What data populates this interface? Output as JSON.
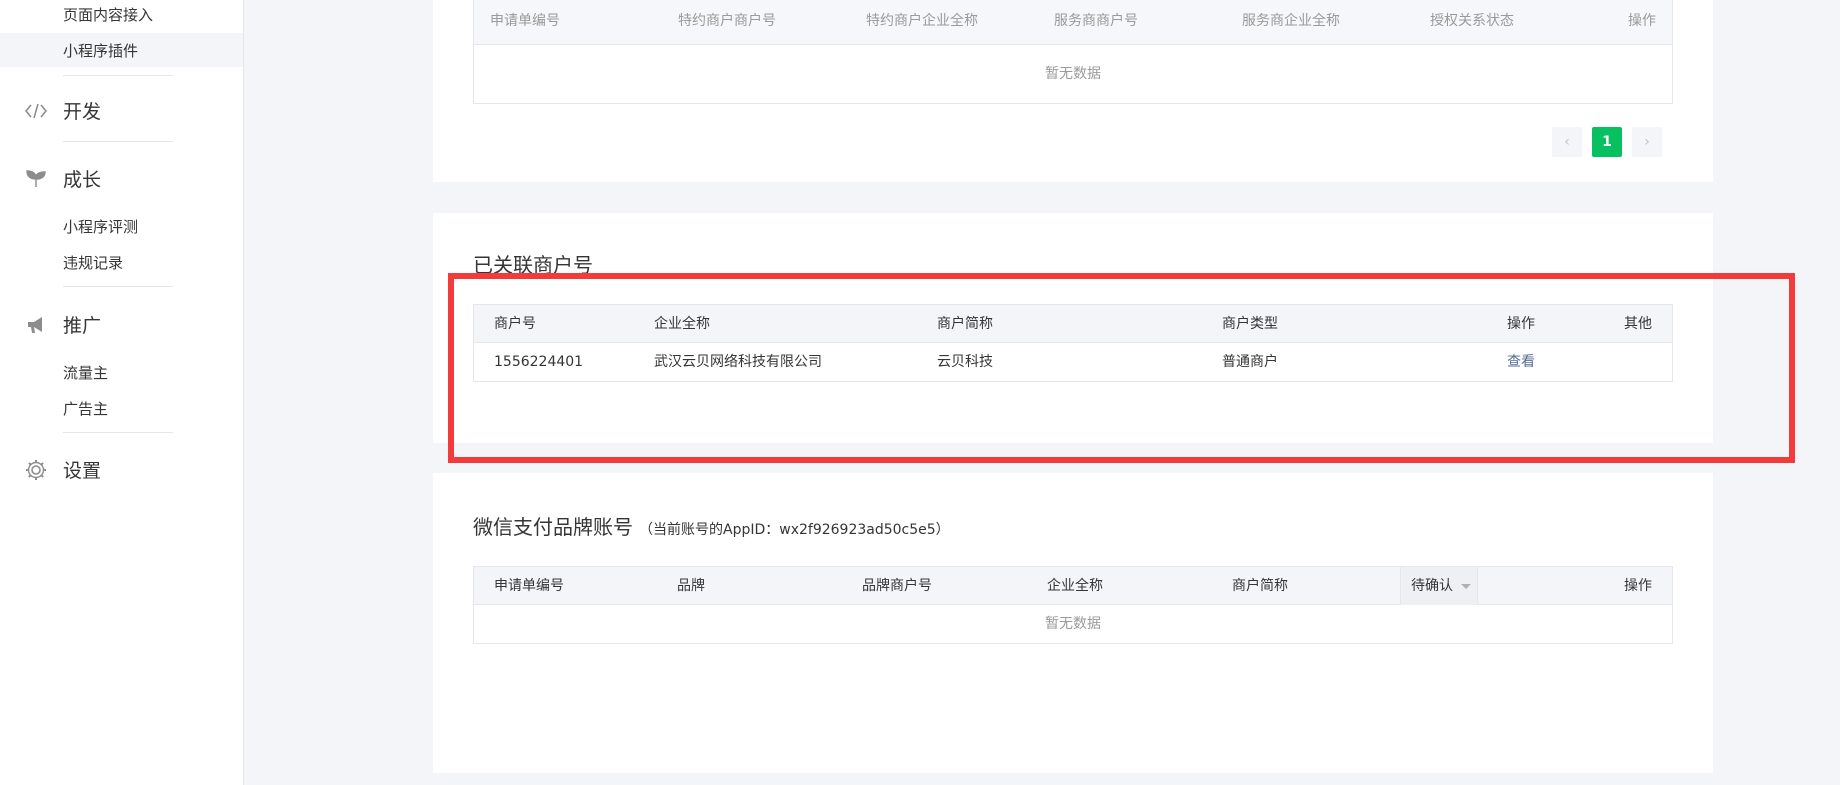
{
  "sidebar": {
    "top_items": [
      "页面内容接入",
      "小程序插件"
    ],
    "sections": [
      {
        "label": "开发",
        "icon": "code-icon",
        "items": []
      },
      {
        "label": "成长",
        "icon": "sprout-icon",
        "items": [
          "小程序评测",
          "违规记录"
        ]
      },
      {
        "label": "推广",
        "icon": "megaphone-icon",
        "items": [
          "流量主",
          "广告主"
        ]
      },
      {
        "label": "设置",
        "icon": "gear-icon",
        "items": []
      }
    ]
  },
  "auth_table": {
    "headers": [
      "申请单编号",
      "特约商户商户号",
      "特约商户企业全称",
      "服务商商户号",
      "服务商企业全称",
      "授权关系状态",
      "操作"
    ],
    "empty_text": "暂无数据",
    "pager": {
      "prev": "‹",
      "current": "1",
      "next": "›"
    }
  },
  "linked": {
    "title": "已关联商户号",
    "headers": [
      "商户号",
      "企业全称",
      "商户简称",
      "商户类型",
      "操作",
      "其他"
    ],
    "rows": [
      {
        "merchant_id": "1556224401",
        "company": "武汉云贝网络科技有限公司",
        "short_name": "云贝科技",
        "type": "普通商户",
        "action": "查看",
        "other": ""
      }
    ]
  },
  "brand": {
    "title": "微信支付品牌账号",
    "subtitle": "（当前账号的AppID：wx2f926923ad50c5e5）",
    "headers": [
      "申请单编号",
      "品牌",
      "品牌商户号",
      "企业全称",
      "商户简称",
      "操作"
    ],
    "status_filter": "待确认",
    "empty_text": "暂无数据"
  },
  "colors": {
    "accent": "#07c160",
    "link": "#576b95",
    "highlight": "#f33b3b"
  }
}
